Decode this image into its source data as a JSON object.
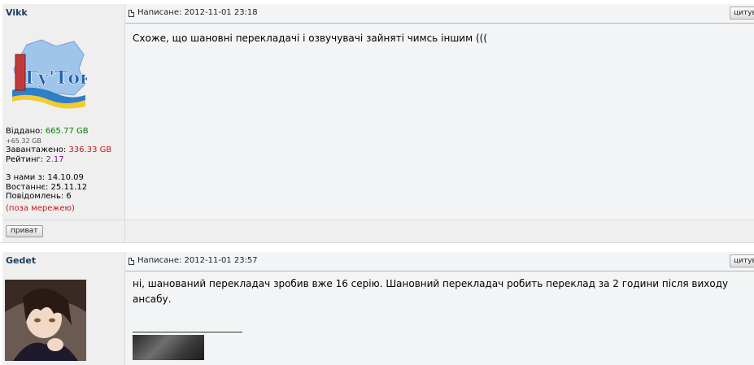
{
  "posts": [
    {
      "username": "Vikk",
      "avatar_text": "Гу'Ток",
      "stats": {
        "given_label": "Віддано:",
        "given_value": "665.77 GB",
        "given_delta": "+65.32 GB",
        "downloaded_label": "Завантажено:",
        "downloaded_value": "336.33 GB",
        "rating_label": "Рейтинг:",
        "rating_value": "2.17",
        "joined": "З нами з: 14.10.09",
        "last": "Востаннє: 25.11.12",
        "messages": "Повідомлень: 6",
        "status": "(поза мережею)"
      },
      "header_text": "Написане: 2012-11-01 23:18",
      "quote_label": "цитув",
      "message": "Схоже, що шановні перекладачі і озвучувачі зайняті чимсь іншим (((",
      "pm_label": "приват"
    },
    {
      "username": "Gedet",
      "header_text": "Написане: 2012-11-01 23:57",
      "quote_label": "цитув",
      "message_line1": "ні, шанований перекладач зробив вже 16 серію. Шановний перекладач робить переклад за 2 години після виходу",
      "message_line2": "ансабу."
    }
  ],
  "colors": {
    "username": "#1b3b5e",
    "given": "#0a7a0a",
    "downloaded": "#c01818",
    "rating": "#7a1a8c",
    "row_bg": "#efefef",
    "post_bg": "#f3f4f5"
  }
}
